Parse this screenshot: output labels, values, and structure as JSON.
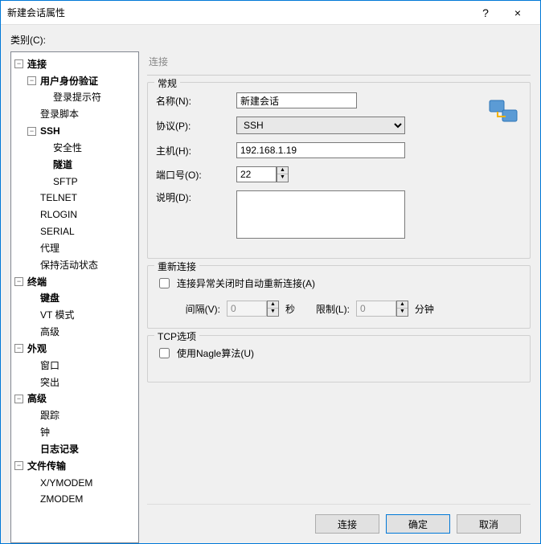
{
  "window": {
    "title": "新建会话属性",
    "help": "?",
    "close": "×"
  },
  "category_label": "类别(C):",
  "tree": {
    "connection": "连接",
    "auth": "用户身份验证",
    "login_prompt": "登录提示符",
    "login_script": "登录脚本",
    "ssh": "SSH",
    "security": "安全性",
    "tunnel": "隧道",
    "sftp": "SFTP",
    "telnet": "TELNET",
    "rlogin": "RLOGIN",
    "serial": "SERIAL",
    "proxy": "代理",
    "keepalive": "保持活动状态",
    "terminal": "终端",
    "keyboard": "键盘",
    "vt_mode": "VT 模式",
    "advanced_term": "高级",
    "appearance": "外观",
    "window": "窗口",
    "highlight": "突出",
    "advanced": "高级",
    "trace": "跟踪",
    "bell": "钟",
    "logging": "日志记录",
    "file_transfer": "文件传输",
    "xymodem": "X/YMODEM",
    "zmodem": "ZMODEM"
  },
  "panel": {
    "header": "连接",
    "general": {
      "legend": "常规",
      "name_label": "名称(N):",
      "name_value": "新建会话",
      "protocol_label": "协议(P):",
      "protocol_value": "SSH",
      "host_label": "主机(H):",
      "host_value": "192.168.1.19",
      "port_label": "端口号(O):",
      "port_value": "22",
      "desc_label": "说明(D):",
      "desc_value": ""
    },
    "reconnect": {
      "legend": "重新连接",
      "checkbox_label": "连接异常关闭时自动重新连接(A)",
      "interval_label": "间隔(V):",
      "interval_value": "0",
      "interval_unit": "秒",
      "limit_label": "限制(L):",
      "limit_value": "0",
      "limit_unit": "分钟"
    },
    "tcp": {
      "legend": "TCP选项",
      "nagle_label": "使用Nagle算法(U)"
    }
  },
  "buttons": {
    "connect": "连接",
    "ok": "确定",
    "cancel": "取消"
  }
}
